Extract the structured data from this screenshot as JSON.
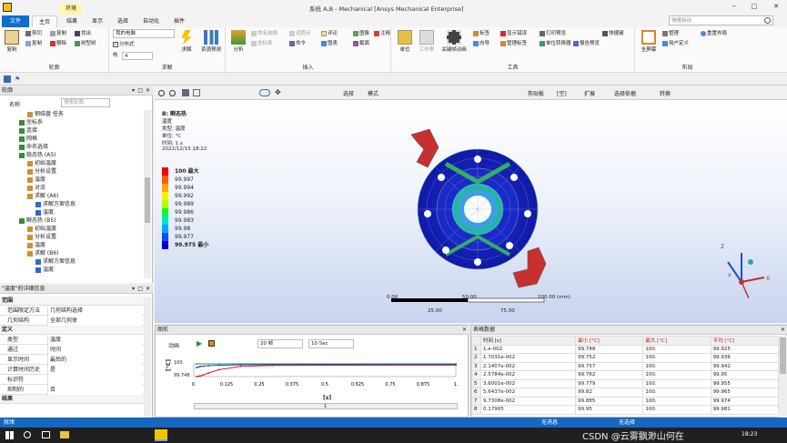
{
  "window": {
    "title": "系统 A,B - Mechanical [Ansys Mechanical Enterprise]",
    "context_tab": "环境"
  },
  "tabs": [
    {
      "label": "文件",
      "active": false
    },
    {
      "label": "主页",
      "active": true
    },
    {
      "label": "结果",
      "active": false
    },
    {
      "label": "显示",
      "active": false
    },
    {
      "label": "选择",
      "active": false
    },
    {
      "label": "自动化",
      "active": false
    },
    {
      "label": "插件",
      "active": false
    }
  ],
  "search": {
    "placeholder": "快速启动"
  },
  "ribbon": {
    "outline_group": {
      "label": "轮廓",
      "paste": "复制",
      "cut": "剪切",
      "copy": "复制",
      "duplicate": "复制",
      "delete": "删除",
      "find": "找出",
      "tree": "树型树"
    },
    "solve_group": {
      "label": "求解",
      "config": "我的电脑",
      "distributed": "分布式",
      "cores_label": "核",
      "cores_value": "4",
      "solve": "求解",
      "resources": "资源预测"
    },
    "insert_group": {
      "label": "插入",
      "analysis": "分析",
      "named_sel": "命名选择",
      "coord": "坐标系",
      "remote": "远程点",
      "cmd": "命令",
      "comment": "评论",
      "chart": "图表",
      "image": "图像",
      "section": "截面",
      "annotation": "注释"
    },
    "tools_group": {
      "label": "工具",
      "units": "单位",
      "worksheet": "工作表",
      "keyframe": "关键帧动画",
      "tag": "标签",
      "display_errors": "显示错误",
      "print_preview": "打印预览",
      "shortcuts": "快捷键",
      "wizard": "向导",
      "manage_tags": "管理标签",
      "unit_converter": "单位转换器",
      "report_preview": "报告预览"
    },
    "layout_group": {
      "label": "布局",
      "full_screen": "全屏幕",
      "manage": "管理",
      "user_defined": "用户定义",
      "reset_layout": "重置布局"
    }
  },
  "outline": {
    "title": "轮廓",
    "name_label": "名称",
    "search_placeholder": "搜索轮廓",
    "items": [
      {
        "label": "钢结盘 任务",
        "depth": 2
      },
      {
        "label": "坐标系",
        "depth": 1
      },
      {
        "label": "连接",
        "depth": 1
      },
      {
        "label": "网格",
        "depth": 1
      },
      {
        "label": "命名选择",
        "depth": 1
      },
      {
        "label": "稳态热 (A5)",
        "depth": 1
      },
      {
        "label": "初始温度",
        "depth": 2
      },
      {
        "label": "分析设置",
        "depth": 2
      },
      {
        "label": "温度",
        "depth": 2
      },
      {
        "label": "对流",
        "depth": 2
      },
      {
        "label": "求解 (A6)",
        "depth": 2
      },
      {
        "label": "求解方案信息",
        "depth": 3
      },
      {
        "label": "温度",
        "depth": 3
      },
      {
        "label": "瞬态热 (B5)",
        "depth": 1
      },
      {
        "label": "初始温度",
        "depth": 2
      },
      {
        "label": "分析设置",
        "depth": 2
      },
      {
        "label": "温度",
        "depth": 2
      },
      {
        "label": "求解 (B6)",
        "depth": 2
      },
      {
        "label": "求解方案信息",
        "depth": 3
      },
      {
        "label": "温度",
        "depth": 3
      }
    ]
  },
  "details": {
    "title": "\"温度\"的详细信息",
    "sections": [
      {
        "header": "范围",
        "rows": [
          {
            "k": "范围限定方法",
            "v": "几何结构选择"
          },
          {
            "k": "几何结构",
            "v": "全部几何体"
          }
        ]
      },
      {
        "header": "定义",
        "rows": [
          {
            "k": "类型",
            "v": "温度"
          },
          {
            "k": "通过",
            "v": "时间"
          },
          {
            "k": "显示时间",
            "v": "最后的"
          },
          {
            "k": "计算时间历史",
            "v": "是"
          },
          {
            "k": "标识符",
            "v": ""
          },
          {
            "k": "抑制的",
            "v": "否"
          }
        ]
      },
      {
        "header": "结果",
        "rows": []
      }
    ]
  },
  "toolbar": {
    "select": "选择",
    "mode": "模式",
    "clipboard": "剪贴板",
    "empty": "[空]",
    "expand": "扩展",
    "select_dep": "选择依据",
    "convert": "转换"
  },
  "viewport": {
    "info_title": "B: 瞬态热",
    "info_lines": [
      "温度",
      "类型: 温度",
      "单位: °C",
      "时间: 1 s",
      "2022/12/15 18:22"
    ],
    "legend": [
      {
        "label": "100 最大",
        "color": "#ff0000"
      },
      {
        "label": "99.997",
        "color": "#ff5a00"
      },
      {
        "label": "99.994",
        "color": "#ffaa00"
      },
      {
        "label": "99.992",
        "color": "#fff000"
      },
      {
        "label": "99.989",
        "color": "#b4ff00"
      },
      {
        "label": "99.986",
        "color": "#00ff30"
      },
      {
        "label": "99.983",
        "color": "#00e6c8"
      },
      {
        "label": "99.98",
        "color": "#00aaff"
      },
      {
        "label": "99.977",
        "color": "#0050ff"
      },
      {
        "label": "99.975 最小",
        "color": "#0000d0"
      }
    ],
    "logo": "Ansys",
    "version": "2022 R2",
    "scale": {
      "ticks": [
        "0.00",
        "50.00",
        "100.00 (mm)"
      ],
      "mid_ticks": [
        "25.00",
        "75.00"
      ]
    },
    "triad": {
      "x": "X",
      "y": "Y",
      "z": "Z"
    }
  },
  "graph": {
    "title": "图形",
    "animation_label": "动画",
    "frames": "20 帧",
    "duration": "10 Sec",
    "ylabel": "[°C]",
    "y_ticks": [
      "100.",
      "99.748"
    ],
    "xlabel": "[s]",
    "x_ticks": [
      "0.",
      "0.125",
      "0.25",
      "0.375",
      "0.5",
      "0.625",
      "0.75",
      "0.875",
      "1."
    ],
    "frame_index": "1"
  },
  "chart_data": {
    "type": "line",
    "xlabel": "[s]",
    "ylabel": "[°C]",
    "xlim": [
      0,
      1
    ],
    "ylim": [
      99.748,
      100
    ],
    "series": [
      {
        "name": "最小 [°C]",
        "color": "#d02020",
        "x": [
          0.01,
          0.017,
          0.021,
          0.026,
          0.036,
          0.056,
          0.097,
          0.179,
          0.3,
          0.5,
          0.75,
          1.0
        ],
        "y": [
          99.748,
          99.752,
          99.757,
          99.762,
          99.779,
          99.82,
          99.885,
          99.95,
          99.968,
          99.973,
          99.975,
          99.975
        ]
      },
      {
        "name": "最大 [°C]",
        "color": "#20a020",
        "x": [
          0.01,
          1.0
        ],
        "y": [
          100,
          100
        ]
      },
      {
        "name": "平均 [°C]",
        "color": "#2040d0",
        "x": [
          0.01,
          0.017,
          0.021,
          0.026,
          0.036,
          0.056,
          0.097,
          0.179,
          0.3,
          0.5,
          0.75,
          1.0
        ],
        "y": [
          99.925,
          99.936,
          99.942,
          99.95,
          99.955,
          99.965,
          99.974,
          99.981,
          99.985,
          99.987,
          99.988,
          99.988
        ]
      }
    ]
  },
  "table": {
    "title": "表格数据",
    "headers": [
      "时间 [s]",
      "最小 [°C]",
      "最大 [°C]",
      "平均 [°C]"
    ],
    "rows": [
      [
        "1",
        "1.e-002",
        "99.748",
        "100.",
        "99.925"
      ],
      [
        "2",
        "1.7031e-002",
        "99.752",
        "100.",
        "99.936"
      ],
      [
        "3",
        "2.1407e-002",
        "99.757",
        "100.",
        "99.942"
      ],
      [
        "4",
        "2.5784e-002",
        "99.762",
        "100.",
        "99.95"
      ],
      [
        "5",
        "3.6001e-002",
        "99.779",
        "100.",
        "99.955"
      ],
      [
        "6",
        "5.6437e-002",
        "99.82",
        "100.",
        "99.965"
      ],
      [
        "7",
        "9.7308e-002",
        "99.885",
        "100.",
        "99.974"
      ],
      [
        "8",
        "0.17905",
        "99.95",
        "100.",
        "99.981"
      ]
    ]
  },
  "status": {
    "ready": "就绪",
    "messages": "无消息",
    "selection": "无选择"
  },
  "taskbar": {
    "time": "18:23",
    "watermark": "CSDN @云雾飘渺山何在"
  }
}
